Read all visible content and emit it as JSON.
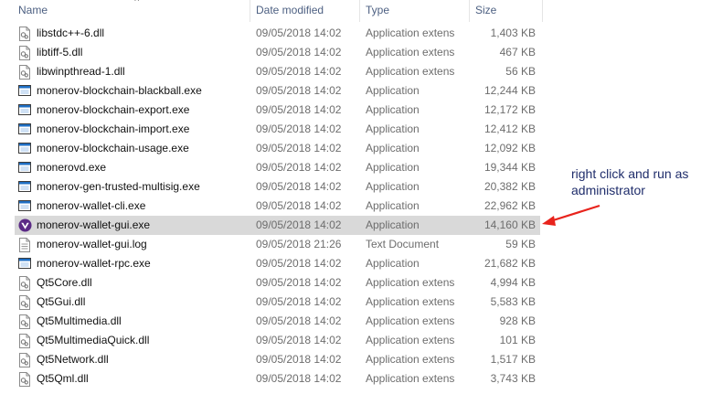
{
  "columns": {
    "name": "Name",
    "date": "Date modified",
    "type": "Type",
    "size": "Size"
  },
  "files": [
    {
      "name": "libstdc++-6.dll",
      "date": "09/05/2018 14:02",
      "type": "Application extens",
      "size": "1,403 KB",
      "icon": "dll-file-icon"
    },
    {
      "name": "libtiff-5.dll",
      "date": "09/05/2018 14:02",
      "type": "Application extens",
      "size": "467 KB",
      "icon": "dll-file-icon"
    },
    {
      "name": "libwinpthread-1.dll",
      "date": "09/05/2018 14:02",
      "type": "Application extens",
      "size": "56 KB",
      "icon": "dll-file-icon"
    },
    {
      "name": "monerov-blockchain-blackball.exe",
      "date": "09/05/2018 14:02",
      "type": "Application",
      "size": "12,244 KB",
      "icon": "exe-window-icon"
    },
    {
      "name": "monerov-blockchain-export.exe",
      "date": "09/05/2018 14:02",
      "type": "Application",
      "size": "12,172 KB",
      "icon": "exe-window-icon"
    },
    {
      "name": "monerov-blockchain-import.exe",
      "date": "09/05/2018 14:02",
      "type": "Application",
      "size": "12,412 KB",
      "icon": "exe-window-icon"
    },
    {
      "name": "monerov-blockchain-usage.exe",
      "date": "09/05/2018 14:02",
      "type": "Application",
      "size": "12,092 KB",
      "icon": "exe-window-icon"
    },
    {
      "name": "monerovd.exe",
      "date": "09/05/2018 14:02",
      "type": "Application",
      "size": "19,344 KB",
      "icon": "exe-window-icon"
    },
    {
      "name": "monerov-gen-trusted-multisig.exe",
      "date": "09/05/2018 14:02",
      "type": "Application",
      "size": "20,382 KB",
      "icon": "exe-window-icon"
    },
    {
      "name": "monerov-wallet-cli.exe",
      "date": "09/05/2018 14:02",
      "type": "Application",
      "size": "22,962 KB",
      "icon": "exe-window-icon"
    },
    {
      "name": "monerov-wallet-gui.exe",
      "date": "09/05/2018 14:02",
      "type": "Application",
      "size": "14,160 KB",
      "icon": "monerov-logo-icon",
      "selected": true
    },
    {
      "name": "monerov-wallet-gui.log",
      "date": "09/05/2018 21:26",
      "type": "Text Document",
      "size": "59 KB",
      "icon": "text-file-icon"
    },
    {
      "name": "monerov-wallet-rpc.exe",
      "date": "09/05/2018 14:02",
      "type": "Application",
      "size": "21,682 KB",
      "icon": "exe-window-icon"
    },
    {
      "name": "Qt5Core.dll",
      "date": "09/05/2018 14:02",
      "type": "Application extens",
      "size": "4,994 KB",
      "icon": "dll-file-icon"
    },
    {
      "name": "Qt5Gui.dll",
      "date": "09/05/2018 14:02",
      "type": "Application extens",
      "size": "5,583 KB",
      "icon": "dll-file-icon"
    },
    {
      "name": "Qt5Multimedia.dll",
      "date": "09/05/2018 14:02",
      "type": "Application extens",
      "size": "928 KB",
      "icon": "dll-file-icon"
    },
    {
      "name": "Qt5MultimediaQuick.dll",
      "date": "09/05/2018 14:02",
      "type": "Application extens",
      "size": "101 KB",
      "icon": "dll-file-icon"
    },
    {
      "name": "Qt5Network.dll",
      "date": "09/05/2018 14:02",
      "type": "Application extens",
      "size": "1,517 KB",
      "icon": "dll-file-icon"
    },
    {
      "name": "Qt5Qml.dll",
      "date": "09/05/2018 14:02",
      "type": "Application extens",
      "size": "3,743 KB",
      "icon": "dll-file-icon"
    }
  ],
  "annotation": {
    "text": "right click and run as\nadministrator",
    "color": "#1f2d6b",
    "arrow_color": "#e8231c"
  },
  "colors": {
    "selection": "#d9d9d9",
    "header_text": "#4d6082",
    "secondary_text": "#6d6d6d",
    "exe_icon_blue": "#1f6fc4",
    "monerov_purple": "#5b2a86"
  }
}
